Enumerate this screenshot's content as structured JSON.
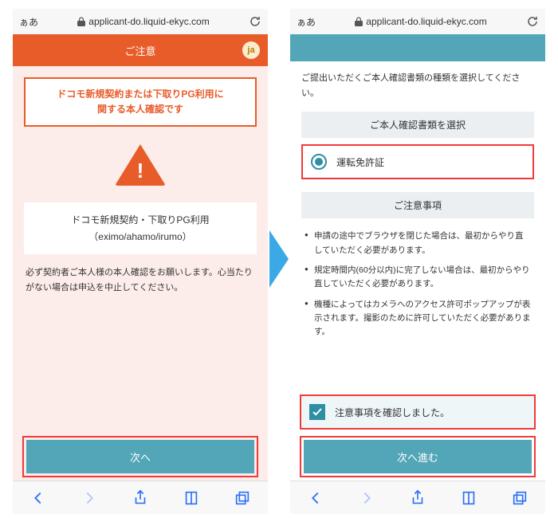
{
  "address": {
    "aa": "ぁあ",
    "url": "applicant-do.liquid-ekyc.com"
  },
  "left": {
    "header_title": "ご注意",
    "lang": "ja",
    "notice_line1": "ドコモ新規契約または下取りPG利用に",
    "notice_line2": "関する本人確認です",
    "card_line1": "ドコモ新規契約・下取りPG利用",
    "card_line2": "（eximo/ahamo/irumo）",
    "paragraph": "必ず契約者ご本人様の本人確認をお願いします。心当たりがない場合は申込を中止してください。",
    "next_label": "次へ"
  },
  "right": {
    "intro": "ご提出いただくご本人確認書類の種類を選択してください。",
    "section_select": "ご本人確認書類を選択",
    "doc_option": "運転免許証",
    "section_notes": "ご注意事項",
    "bullets": [
      "申請の途中でブラウザを閉じた場合は、最初からやり直していただく必要があります。",
      "規定時間内(60分以内)に完了しない場合は、最初からやり直していただく必要があります。",
      "機種によってはカメラへのアクセス許可ポップアップが表示されます。撮影のために許可していただく必要があります。"
    ],
    "confirm_label": "注意事項を確認しました。",
    "next_label": "次へ進む"
  },
  "colors": {
    "accent_orange": "#e85c2a",
    "accent_teal": "#52a6b8",
    "highlight_red": "#f03a3a",
    "ios_blue": "#2d6ff6"
  }
}
